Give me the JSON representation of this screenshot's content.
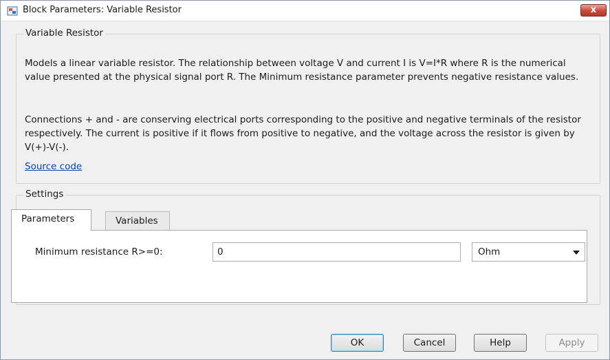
{
  "window": {
    "title": "Block Parameters: Variable Resistor",
    "close_label": "x"
  },
  "description": {
    "group_title": "Variable Resistor",
    "paragraph1": "Models a linear variable resistor. The relationship between voltage V and current I is V=I*R where R is the numerical value presented at the physical signal port R. The Minimum resistance parameter prevents negative resistance values.",
    "paragraph2": "Connections + and - are conserving electrical ports corresponding to the positive and negative terminals of the resistor respectively. The current is positive if it flows from positive to negative, and the voltage across the resistor is given by V(+)-V(-).",
    "source_link": "Source code"
  },
  "settings": {
    "group_title": "Settings",
    "tabs": [
      {
        "label": "Parameters",
        "active": true
      },
      {
        "label": "Variables",
        "active": false
      }
    ],
    "params": {
      "min_resistance_label": "Minimum resistance R>=0:",
      "min_resistance_value": "0",
      "unit_value": "Ohm"
    }
  },
  "buttons": {
    "ok": "OK",
    "cancel": "Cancel",
    "help": "Help",
    "apply": "Apply"
  },
  "icons": {
    "title_icon": "simulink-block-icon",
    "dropdown_icon": "chevron-down-icon"
  }
}
